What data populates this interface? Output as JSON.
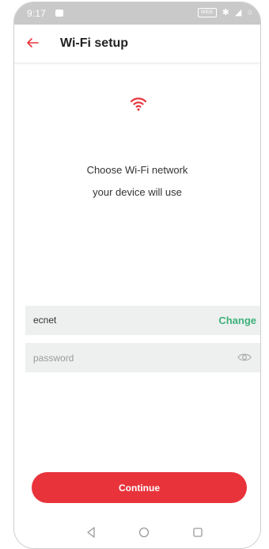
{
  "status_bar": {
    "time": "9:17",
    "wide_badge": "WIDE"
  },
  "header": {
    "title": "Wi-Fi setup"
  },
  "instruction": {
    "line1": "Choose Wi-Fi network",
    "line2": "your device will use"
  },
  "network": {
    "name": "ecnet",
    "change_label": "Change"
  },
  "password": {
    "placeholder": "password"
  },
  "continue_label": "Continue",
  "colors": {
    "accent": "#e8333b",
    "link": "#3fb17a",
    "field_bg": "#eef0f0",
    "status_bg": "#c9c9c9"
  }
}
